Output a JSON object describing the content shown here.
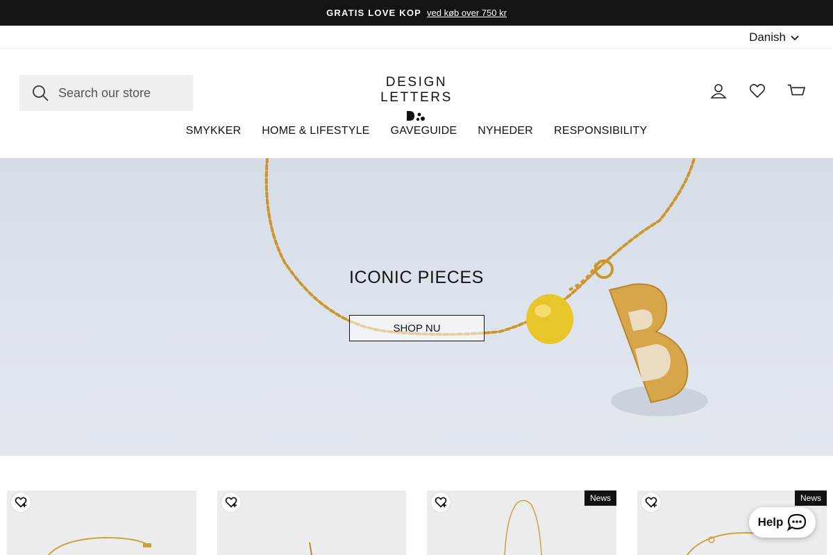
{
  "announcement": {
    "strong": "GRATIS LOVE KOP",
    "link": "ved køb over 750 kr"
  },
  "language": {
    "selected": "Danish"
  },
  "search": {
    "placeholder": "Search our store"
  },
  "logo": {
    "wordmark": "DESIGN LETTERS"
  },
  "header_icons": [
    "account-icon",
    "heart-icon",
    "cart-icon"
  ],
  "nav": {
    "items": [
      "SMYKKER",
      "HOME & LIFESTYLE",
      "GAVEGUIDE",
      "NYHEDER",
      "RESPONSIBILITY"
    ]
  },
  "hero": {
    "title": "ICONIC PIECES",
    "cta": "SHOP NU"
  },
  "products": [
    {
      "badge": ""
    },
    {
      "badge": ""
    },
    {
      "badge": "News"
    },
    {
      "badge": "News"
    }
  ],
  "help": {
    "label": "Help"
  }
}
